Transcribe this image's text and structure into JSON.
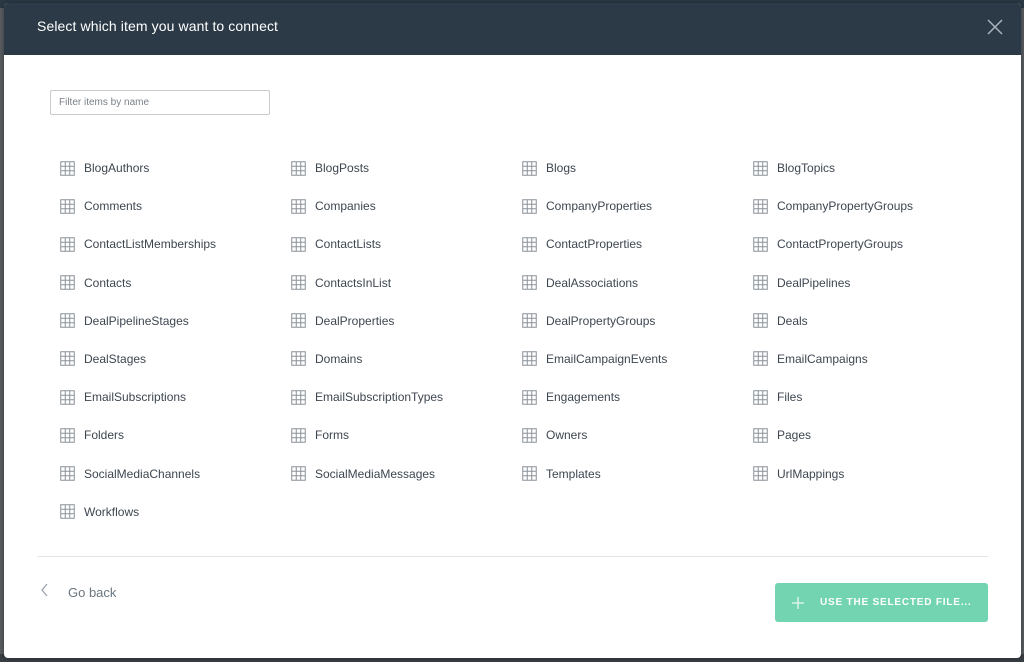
{
  "header": {
    "title": "Select which item you want to connect"
  },
  "filter": {
    "placeholder": "Filter items by name",
    "value": ""
  },
  "items": [
    "BlogAuthors",
    "BlogPosts",
    "Blogs",
    "BlogTopics",
    "Comments",
    "Companies",
    "CompanyProperties",
    "CompanyPropertyGroups",
    "ContactListMemberships",
    "ContactLists",
    "ContactProperties",
    "ContactPropertyGroups",
    "Contacts",
    "ContactsInList",
    "DealAssociations",
    "DealPipelines",
    "DealPipelineStages",
    "DealProperties",
    "DealPropertyGroups",
    "Deals",
    "DealStages",
    "Domains",
    "EmailCampaignEvents",
    "EmailCampaigns",
    "EmailSubscriptions",
    "EmailSubscriptionTypes",
    "Engagements",
    "Files",
    "Folders",
    "Forms",
    "Owners",
    "Pages",
    "SocialMediaChannels",
    "SocialMediaMessages",
    "Templates",
    "UrlMappings",
    "Workflows"
  ],
  "item_icon": "table-grid-icon",
  "footer": {
    "back_label": "Go back",
    "use_label": "USE THE SELECTED FILE..."
  },
  "colors": {
    "header_bg": "#2c3a47",
    "accent": "#72d4b0",
    "icon": "#8a9199"
  }
}
